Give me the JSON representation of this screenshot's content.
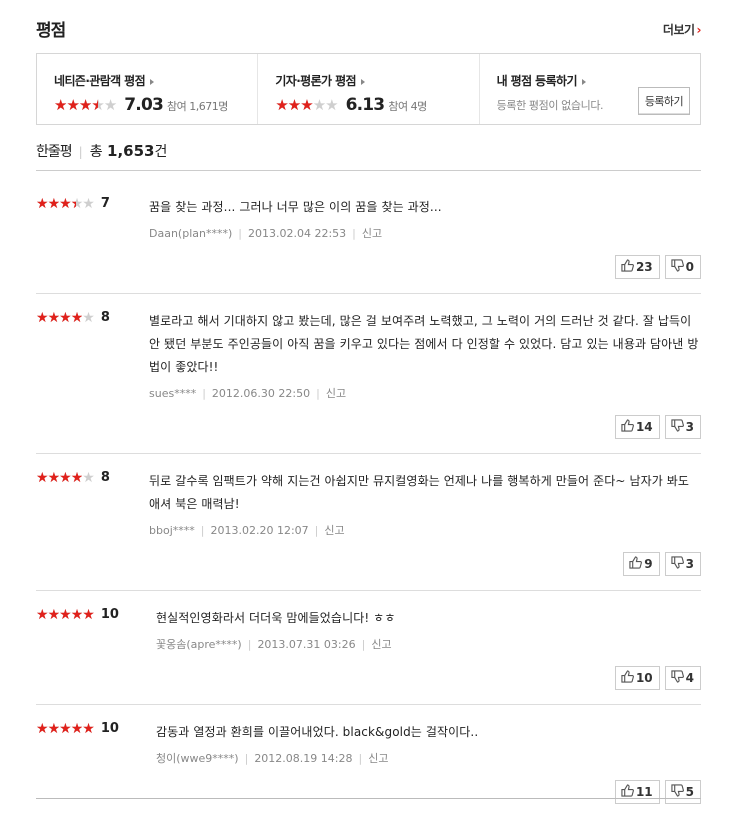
{
  "section": {
    "title": "평점",
    "more_label": "더보기",
    "more_arrow": "›"
  },
  "score_box": {
    "netizen": {
      "title": "네티즌·관람객 평점",
      "score": "7.03",
      "meta": "참여 1,671명",
      "stars_filled": 3.5
    },
    "critic": {
      "title": "기자·평론가 평점",
      "score": "6.13",
      "meta": "참여 4명",
      "stars_filled": 3
    },
    "mine": {
      "title": "내 평점 등록하기",
      "empty_text": "등록한 평점이 없습니다.",
      "register_label": "등록하기"
    }
  },
  "review_head": {
    "label": "한줄평",
    "total_prefix": "총",
    "total_num": "1,653",
    "total_suffix": "건"
  },
  "colors": {
    "accent": "#e0211b",
    "star_empty": "#cfcfcf",
    "border": "#d6d6d6"
  },
  "reviews": [
    {
      "stars_filled": 3.5,
      "point": "7",
      "text": "꿈을 찾는 과정... 그러나 너무 많은 이의 꿈을 찾는 과정...",
      "user": "Daan(plan****)",
      "date": "2013.02.04 22:53",
      "report": "신고",
      "up": "23",
      "down": "0"
    },
    {
      "stars_filled": 4,
      "point": "8",
      "text": "별로라고 해서 기대하지 않고 봤는데, 많은 걸 보여주려 노력했고, 그 노력이 거의 드러난 것 같다. 잘 납득이 안 됐던 부분도 주인공들이 아직 꿈을 키우고 있다는 점에서 다 인정할 수 있었다. 담고 있는 내용과 담아낸 방법이 좋았다!!",
      "user": "sues****",
      "date": "2012.06.30 22:50",
      "report": "신고",
      "up": "14",
      "down": "3"
    },
    {
      "stars_filled": 4,
      "point": "8",
      "text": "뒤로 갈수록 임팩트가 약해 지는건 아쉽지만 뮤지컬영화는 언제나 나를 행복하게 만들어 준다~ 남자가 봐도 애셔 북은 매력남!",
      "user": "bboj****",
      "date": "2013.02.20 12:07",
      "report": "신고",
      "up": "9",
      "down": "3"
    },
    {
      "stars_filled": 5,
      "point": "10",
      "text": "현실적인영화라서 더더욱 맘에들었습니다! ㅎㅎ",
      "user": "꽃옹솜(apre****)",
      "date": "2013.07.31 03:26",
      "report": "신고",
      "up": "10",
      "down": "4"
    },
    {
      "stars_filled": 5,
      "point": "10",
      "text": "감동과 열정과 환희를 이끌어내었다. black&gold는 걸작이다..",
      "user": "청이(wwe9****)",
      "date": "2012.08.19 14:28",
      "report": "신고",
      "up": "11",
      "down": "5"
    }
  ]
}
